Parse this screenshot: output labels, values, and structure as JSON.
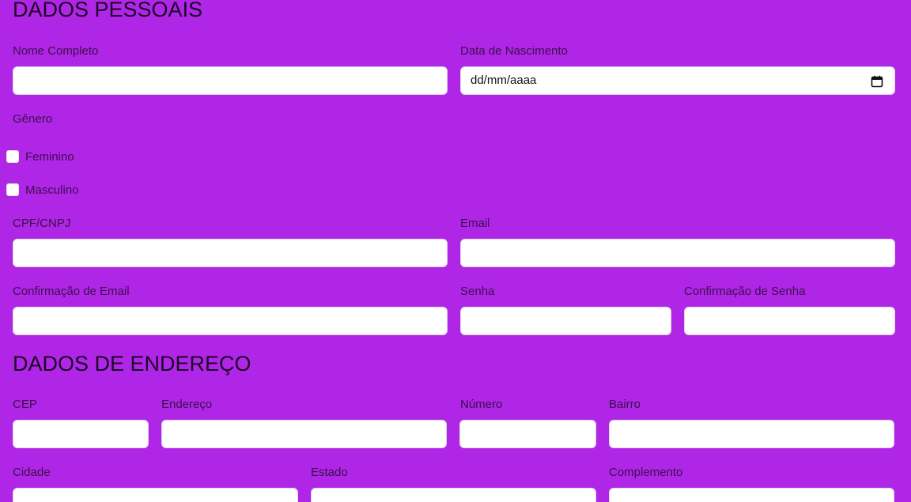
{
  "sections": {
    "personal_title": "DADOS PESSOAIS",
    "address_title": "DADOS DE ENDEREÇO"
  },
  "personal": {
    "full_name_label": "Nome Completo",
    "birth_date_label": "Data de Nascimento",
    "birth_date_placeholder": "dd/mm/aaaa",
    "gender_label": "Gênero",
    "gender_options": [
      "Feminino",
      "Masculino"
    ],
    "cpf_label": "CPF/CNPJ",
    "email_label": "Email",
    "email_confirm_label": "Confirmação de Email",
    "password_label": "Senha",
    "password_confirm_label": "Confirmação de Senha"
  },
  "address": {
    "cep_label": "CEP",
    "street_label": "Endereço",
    "number_label": "Número",
    "district_label": "Bairro",
    "city_label": "Cidade",
    "state_label": "Estado",
    "complement_label": "Complemento"
  },
  "icons": {
    "birth_date_icon": "calendar-icon"
  },
  "colors": {
    "background": "#b026e6",
    "field_background": "#ffffff"
  }
}
